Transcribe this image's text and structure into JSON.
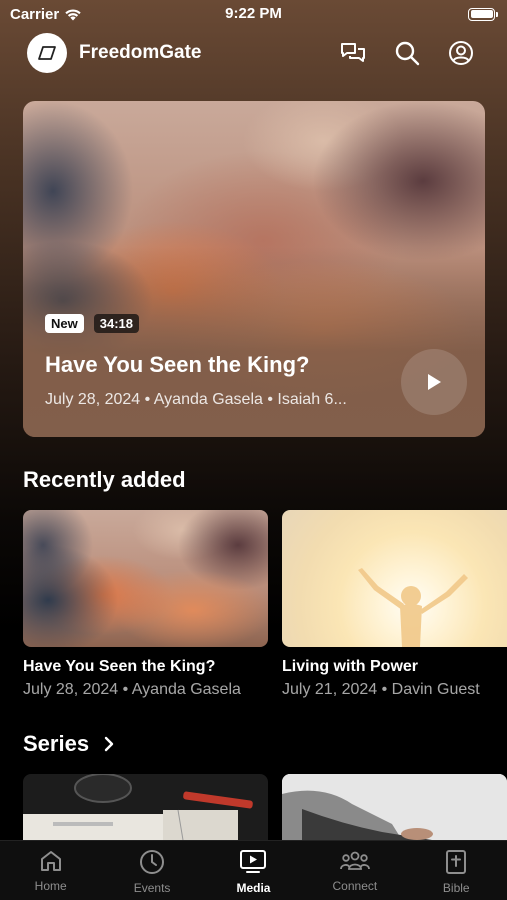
{
  "status_bar": {
    "carrier": "Carrier",
    "time": "9:22 PM"
  },
  "header": {
    "app_name": "FreedomGate",
    "icons": [
      "chat-bubbles-icon",
      "search-icon",
      "profile-icon"
    ]
  },
  "hero": {
    "badge_new": "New",
    "duration": "34:18",
    "title": "Have You Seen the King?",
    "meta": "July 28, 2024 • Ayanda Gasela • Isaiah 6..."
  },
  "recently_added": {
    "title": "Recently added",
    "items": [
      {
        "title": "Have You Seen the King?",
        "meta": "July 28, 2024 • Ayanda Gasela"
      },
      {
        "title": "Living with Power",
        "meta": "July 21, 2024 • Davin Guest"
      }
    ]
  },
  "series": {
    "title": "Series"
  },
  "tabbar": {
    "tabs": [
      {
        "label": "Home",
        "icon": "home-icon"
      },
      {
        "label": "Events",
        "icon": "clock-icon"
      },
      {
        "label": "Media",
        "icon": "media-icon"
      },
      {
        "label": "Connect",
        "icon": "people-icon"
      },
      {
        "label": "Bible",
        "icon": "bible-icon"
      }
    ],
    "active": "Media"
  }
}
